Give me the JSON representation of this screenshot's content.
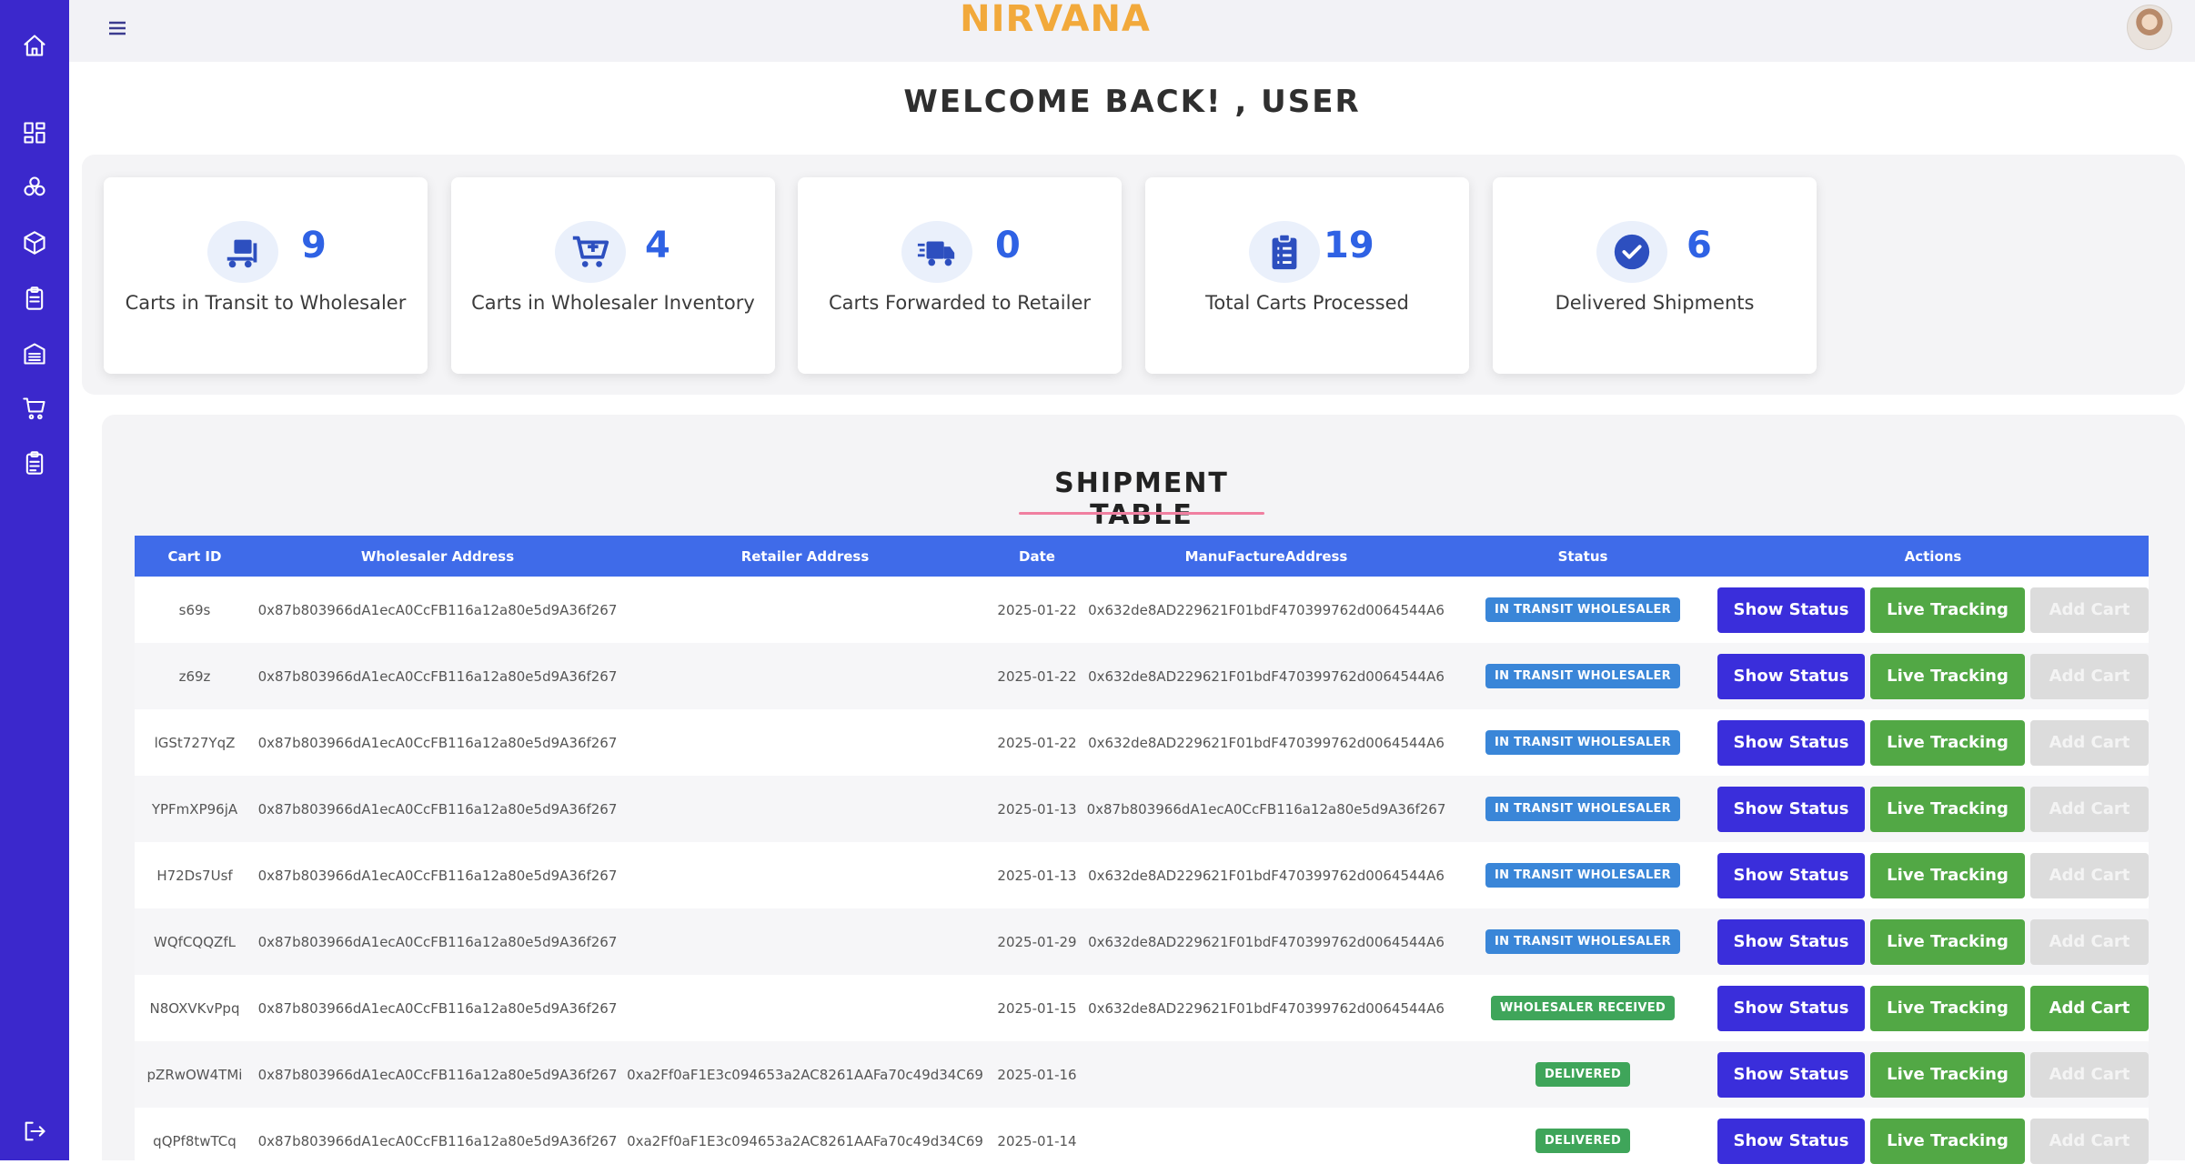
{
  "app": {
    "brand": "NIRVANA"
  },
  "sidebar": {
    "items": [
      {
        "name": "home-icon"
      },
      {
        "name": "dashboard-icon"
      },
      {
        "name": "nodes-icon"
      },
      {
        "name": "box-icon"
      },
      {
        "name": "clipboard-icon"
      },
      {
        "name": "warehouse-icon"
      },
      {
        "name": "cart-icon"
      },
      {
        "name": "checklist-icon"
      },
      {
        "name": "logout-icon"
      }
    ]
  },
  "welcome": "WELCOME BACK! , USER",
  "stats": [
    {
      "icon": "truck-loading-icon",
      "value": "9",
      "label": "Carts in Transit to Wholesaler"
    },
    {
      "icon": "cart-plus-icon",
      "value": "4",
      "label": "Carts in Wholesaler Inventory"
    },
    {
      "icon": "fast-truck-icon",
      "value": "0",
      "label": "Carts Forwarded to Retailer"
    },
    {
      "icon": "clipboard-list-icon",
      "value": "19",
      "label": "Total Carts Processed"
    },
    {
      "icon": "check-circle-icon",
      "value": "6",
      "label": "Delivered Shipments"
    }
  ],
  "table": {
    "title": "SHIPMENT TABLE",
    "headers": [
      "Cart ID",
      "Wholesaler Address",
      "Retailer Address",
      "Date",
      "ManuFactureAddress",
      "Status",
      "Actions"
    ],
    "buttons": {
      "show_status": "Show Status",
      "live_tracking": "Live Tracking",
      "add_cart": "Add Cart"
    },
    "rows": [
      {
        "cart_id": "s69s",
        "wholesaler": "0x87b803966dA1ecA0CcFB116a12a80e5d9A36f267",
        "retailer": "",
        "date": "2025-01-22",
        "manufacturer": "0x632de8AD229621F01bdF470399762d0064544A6",
        "status": "IN TRANSIT WHOLESALER",
        "status_kind": "transit",
        "add_enabled": false
      },
      {
        "cart_id": "z69z",
        "wholesaler": "0x87b803966dA1ecA0CcFB116a12a80e5d9A36f267",
        "retailer": "",
        "date": "2025-01-22",
        "manufacturer": "0x632de8AD229621F01bdF470399762d0064544A6",
        "status": "IN TRANSIT WHOLESALER",
        "status_kind": "transit",
        "add_enabled": false
      },
      {
        "cart_id": "lGSt727YqZ",
        "wholesaler": "0x87b803966dA1ecA0CcFB116a12a80e5d9A36f267",
        "retailer": "",
        "date": "2025-01-22",
        "manufacturer": "0x632de8AD229621F01bdF470399762d0064544A6",
        "status": "IN TRANSIT WHOLESALER",
        "status_kind": "transit",
        "add_enabled": false
      },
      {
        "cart_id": "YPFmXP96jA",
        "wholesaler": "0x87b803966dA1ecA0CcFB116a12a80e5d9A36f267",
        "retailer": "",
        "date": "2025-01-13",
        "manufacturer": "0x87b803966dA1ecA0CcFB116a12a80e5d9A36f267",
        "status": "IN TRANSIT WHOLESALER",
        "status_kind": "transit",
        "add_enabled": false
      },
      {
        "cart_id": "H72Ds7Usf",
        "wholesaler": "0x87b803966dA1ecA0CcFB116a12a80e5d9A36f267",
        "retailer": "",
        "date": "2025-01-13",
        "manufacturer": "0x632de8AD229621F01bdF470399762d0064544A6",
        "status": "IN TRANSIT WHOLESALER",
        "status_kind": "transit",
        "add_enabled": false
      },
      {
        "cart_id": "WQfCQQZfL",
        "wholesaler": "0x87b803966dA1ecA0CcFB116a12a80e5d9A36f267",
        "retailer": "",
        "date": "2025-01-29",
        "manufacturer": "0x632de8AD229621F01bdF470399762d0064544A6",
        "status": "IN TRANSIT WHOLESALER",
        "status_kind": "transit",
        "add_enabled": false
      },
      {
        "cart_id": "N8OXVKvPpq",
        "wholesaler": "0x87b803966dA1ecA0CcFB116a12a80e5d9A36f267",
        "retailer": "",
        "date": "2025-01-15",
        "manufacturer": "0x632de8AD229621F01bdF470399762d0064544A6",
        "status": "WHOLESALER RECEIVED",
        "status_kind": "received",
        "add_enabled": true
      },
      {
        "cart_id": "pZRwOW4TMi",
        "wholesaler": "0x87b803966dA1ecA0CcFB116a12a80e5d9A36f267",
        "retailer": "0xa2Ff0aF1E3c094653a2AC8261AAFa70c49d34C69",
        "date": "2025-01-16",
        "manufacturer": "",
        "status": "DELIVERED",
        "status_kind": "delivered",
        "add_enabled": false
      },
      {
        "cart_id": "qQPf8twTCq",
        "wholesaler": "0x87b803966dA1ecA0CcFB116a12a80e5d9A36f267",
        "retailer": "0xa2Ff0aF1E3c094653a2AC8261AAFa70c49d34C69",
        "date": "2025-01-14",
        "manufacturer": "",
        "status": "DELIVERED",
        "status_kind": "delivered",
        "add_enabled": false
      }
    ]
  }
}
